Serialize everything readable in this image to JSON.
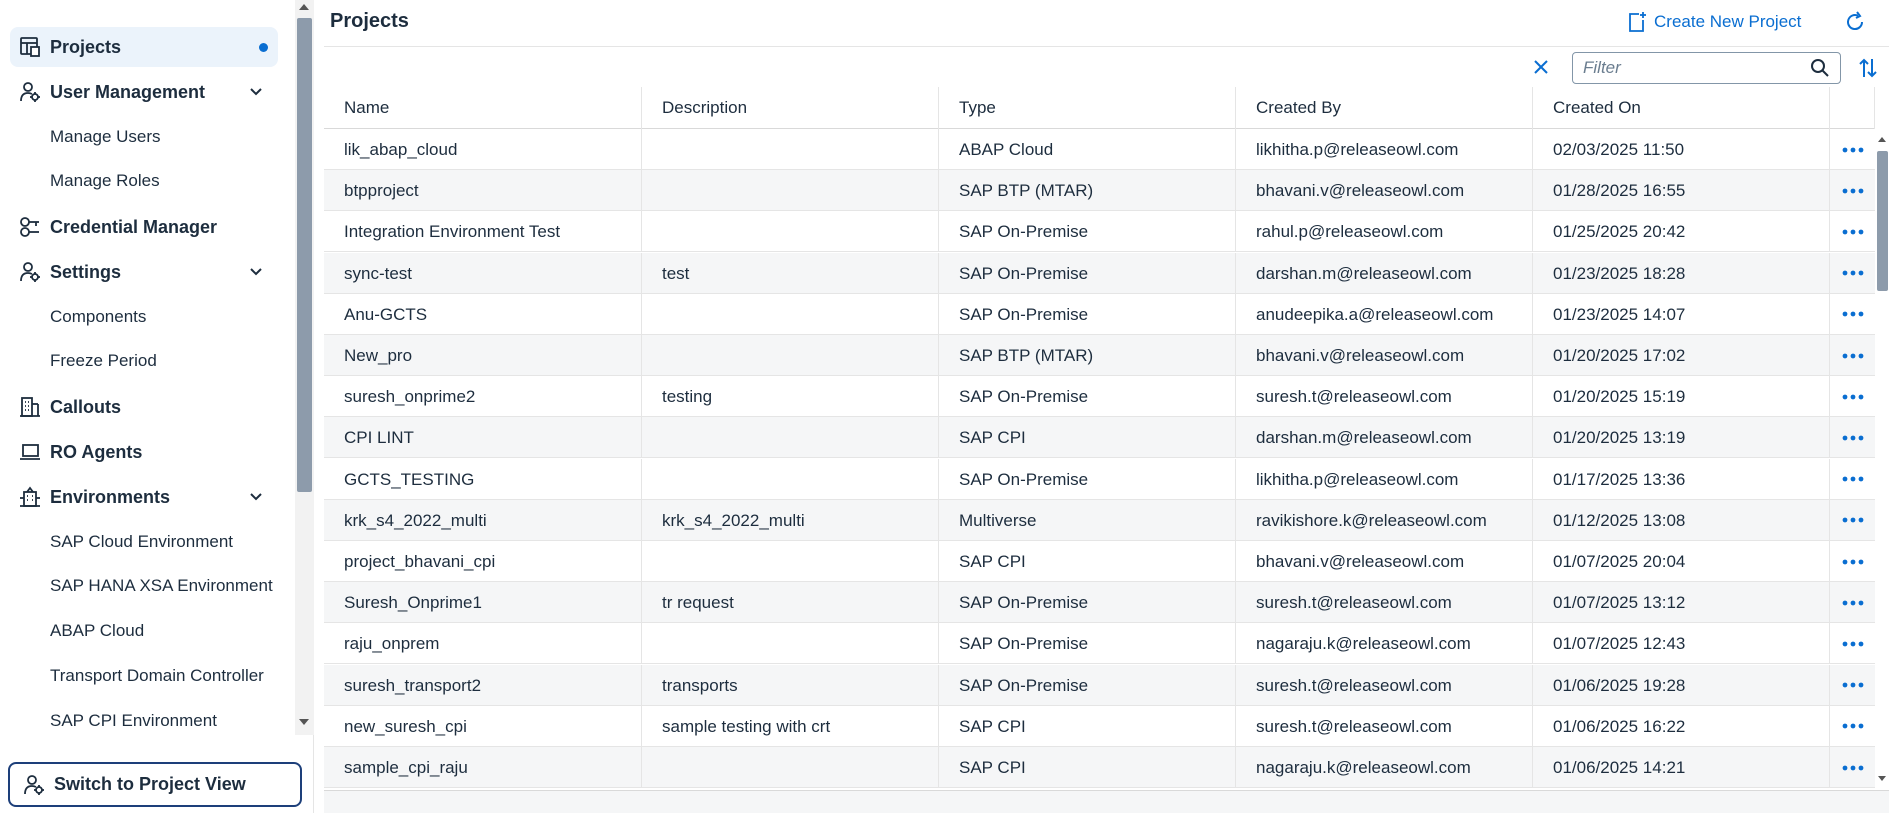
{
  "sidebar": {
    "items": [
      {
        "label": "Projects",
        "icon": "projects-icon"
      },
      {
        "label": "User Management",
        "icon": "user-settings-icon"
      },
      {
        "label": "Credential Manager",
        "icon": "key-icon"
      },
      {
        "label": "Settings",
        "icon": "user-settings-icon"
      },
      {
        "label": "Callouts",
        "icon": "building-icon"
      },
      {
        "label": "RO Agents",
        "icon": "laptop-icon"
      },
      {
        "label": "Environments",
        "icon": "company-icon"
      }
    ],
    "sub": {
      "manage_users": "Manage Users",
      "manage_roles": "Manage Roles",
      "components": "Components",
      "freeze_period": "Freeze Period",
      "sap_cloud_env": "SAP Cloud Environment",
      "sap_hana_xsa_env": "SAP HANA XSA Environment",
      "abap_cloud": "ABAP Cloud",
      "transport_domain_controller": "Transport Domain Controller",
      "sap_cpi_env": "SAP CPI Environment"
    },
    "switch_button": "Switch to Project View"
  },
  "header": {
    "title": "Projects",
    "create_label": "Create New Project"
  },
  "toolbar": {
    "filter_placeholder": "Filter"
  },
  "table": {
    "columns": [
      "Name",
      "Description",
      "Type",
      "Created By",
      "Created On"
    ],
    "rows": [
      [
        "lik_abap_cloud",
        "",
        "ABAP Cloud",
        "likhitha.p@releaseowl.com",
        "02/03/2025 11:50"
      ],
      [
        "btpproject",
        "",
        "SAP BTP (MTAR)",
        "bhavani.v@releaseowl.com",
        "01/28/2025 16:55"
      ],
      [
        "Integration Environment Test",
        "",
        "SAP On-Premise",
        "rahul.p@releaseowl.com",
        "01/25/2025 20:42"
      ],
      [
        "sync-test",
        "test",
        "SAP On-Premise",
        "darshan.m@releaseowl.com",
        "01/23/2025 18:28"
      ],
      [
        "Anu-GCTS",
        "",
        "SAP On-Premise",
        "anudeepika.a@releaseowl.com",
        "01/23/2025 14:07"
      ],
      [
        "New_pro",
        "",
        "SAP BTP (MTAR)",
        "bhavani.v@releaseowl.com",
        "01/20/2025 17:02"
      ],
      [
        "suresh_onprime2",
        "testing",
        "SAP On-Premise",
        "suresh.t@releaseowl.com",
        "01/20/2025 15:19"
      ],
      [
        "CPI LINT",
        "",
        "SAP CPI",
        "darshan.m@releaseowl.com",
        "01/20/2025 13:19"
      ],
      [
        "GCTS_TESTING",
        "",
        "SAP On-Premise",
        "likhitha.p@releaseowl.com",
        "01/17/2025 13:36"
      ],
      [
        "krk_s4_2022_multi",
        "krk_s4_2022_multi",
        "Multiverse",
        "ravikishore.k@releaseowl.com",
        "01/12/2025 13:08"
      ],
      [
        "project_bhavani_cpi",
        "",
        "SAP CPI",
        "bhavani.v@releaseowl.com",
        "01/07/2025 20:04"
      ],
      [
        "Suresh_Onprime1",
        "tr request",
        "SAP On-Premise",
        "suresh.t@releaseowl.com",
        "01/07/2025 13:12"
      ],
      [
        "raju_onprem",
        "",
        "SAP On-Premise",
        "nagaraju.k@releaseowl.com",
        "01/07/2025 12:43"
      ],
      [
        "suresh_transport2",
        "transports",
        "SAP On-Premise",
        "suresh.t@releaseowl.com",
        "01/06/2025 19:28"
      ],
      [
        "new_suresh_cpi",
        "sample testing with crt",
        "SAP CPI",
        "suresh.t@releaseowl.com",
        "01/06/2025 16:22"
      ],
      [
        "sample_cpi_raju",
        "",
        "SAP CPI",
        "nagaraju.k@releaseowl.com",
        "01/06/2025 14:21"
      ]
    ]
  },
  "colors": {
    "accent": "#0a6ed1",
    "text": "#1d2d3e",
    "active_bg": "#ebf3fb"
  }
}
